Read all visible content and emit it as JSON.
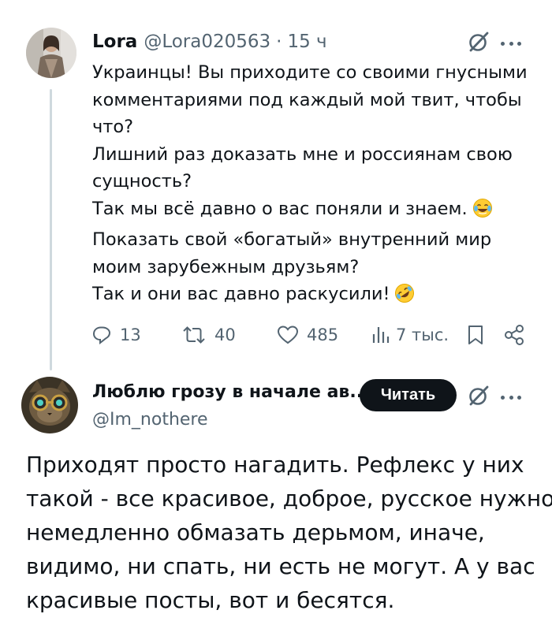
{
  "tweet": {
    "author_name": "Lora",
    "handle": "@Lora020563",
    "separator": "·",
    "time": "15 ч",
    "text_lines": [
      "Украинцы! Вы приходите со своими гнусными",
      "комментариями под каждый мой твит, чтобы",
      "что?",
      "Лишний раз доказать мне и россиянам свою",
      "сущность?",
      "Так мы всё давно о вас поняли и знаем.",
      "Показать свой «богатый» внутренний мир",
      "моим зарубежным друзьям?",
      "Так и они вас давно раскусили!"
    ],
    "emojis": [
      "crying-laughing-emoji",
      "rolling-laughing-emoji"
    ],
    "stats": {
      "replies": "13",
      "retweets": "40",
      "likes": "485",
      "views": "7 тыс."
    }
  },
  "reply": {
    "author_name": "Люблю грозу в начале ав...",
    "handle": "@Im_nothere",
    "follow_label": "Читать",
    "text_lines": [
      "Приходят просто нагадить. Рефлекс у них",
      "такой - все красивое, доброе, русское нужно",
      "немедленно обмазать дерьмом, иначе,",
      "видимо, ни спать, ни есть не могут. А у вас",
      "красивые посты, вот и бесятся."
    ]
  },
  "icons": [
    "grok-icon",
    "more-icon",
    "reply-icon",
    "retweet-icon",
    "like-icon",
    "views-icon",
    "bookmark-icon",
    "share-icon"
  ],
  "colors": {
    "text": "#0f1419",
    "muted": "#536471",
    "thread_line": "#cfd9de",
    "button_bg": "#0f1419",
    "button_text": "#ffffff"
  }
}
